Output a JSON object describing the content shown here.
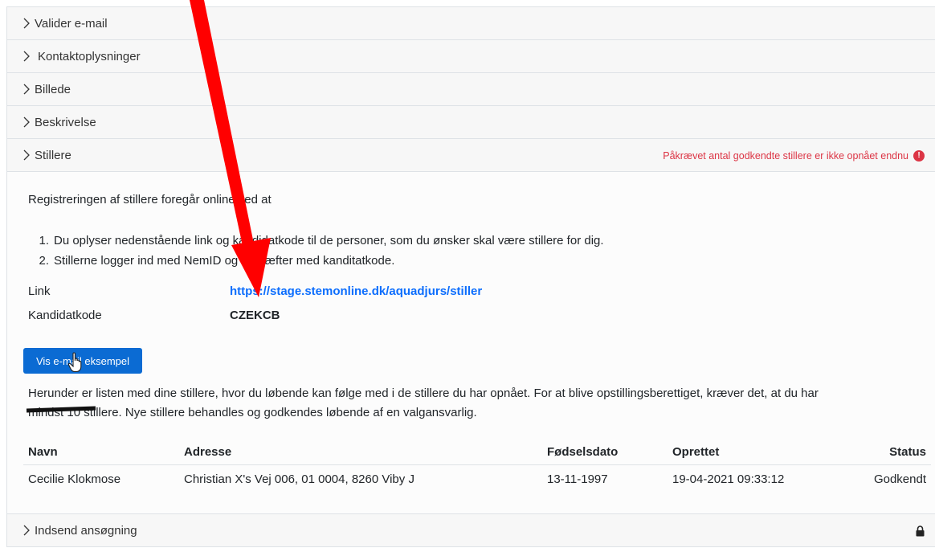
{
  "accordion": {
    "sections": [
      {
        "label": "Valider e-mail"
      },
      {
        "label": "Kontaktoplysninger"
      },
      {
        "label": "Billede"
      },
      {
        "label": "Beskrivelse"
      },
      {
        "label": "Stillere"
      }
    ],
    "stillere_warning": "Påkrævet antal godkendte stillere er ikke opnået endnu",
    "last_section": "Indsend ansøgning"
  },
  "stillere_panel": {
    "intro": "Registreringen af stillere foregår online ved at",
    "steps": [
      {
        "num": "1.",
        "text": "Du oplyser nedenstående link og kandidatkode til de personer, som du ønsker skal være stillere for dig."
      },
      {
        "num": "2.",
        "text": "Stillerne logger ind med NemID og bekræfter med kanditatkode."
      }
    ],
    "link_label": "Link",
    "link_value": "https://stage.stemonline.dk/aquadjurs/stiller",
    "code_label": "Kandidatkode",
    "code_value": "CZEKCB",
    "email_button": "Vis e-mail eksempel",
    "para_line1": "Herunder er listen med dine stillere, hvor du løbende kan følge med i de stillere du har opnået. For at blive opstillingsberettiget, kræver det, at du har",
    "para_line2": "mindst 10 stillere. Nye stillere behandles og godkendes løbende af en valgansvarlig.",
    "table": {
      "headers": [
        "Navn",
        "Adresse",
        "Fødselsdato",
        "Oprettet",
        "Status"
      ],
      "rows": [
        [
          "Cecilie Klokmose",
          "Christian X's Vej 006, 01 0004, 8260 Viby J",
          "13-11-1997",
          "19-04-2021 09:33:12",
          "Godkendt"
        ]
      ]
    }
  },
  "colors": {
    "accent": "#0b6bd3",
    "danger": "#dc3545",
    "annotation_arrow": "#ff0000"
  }
}
